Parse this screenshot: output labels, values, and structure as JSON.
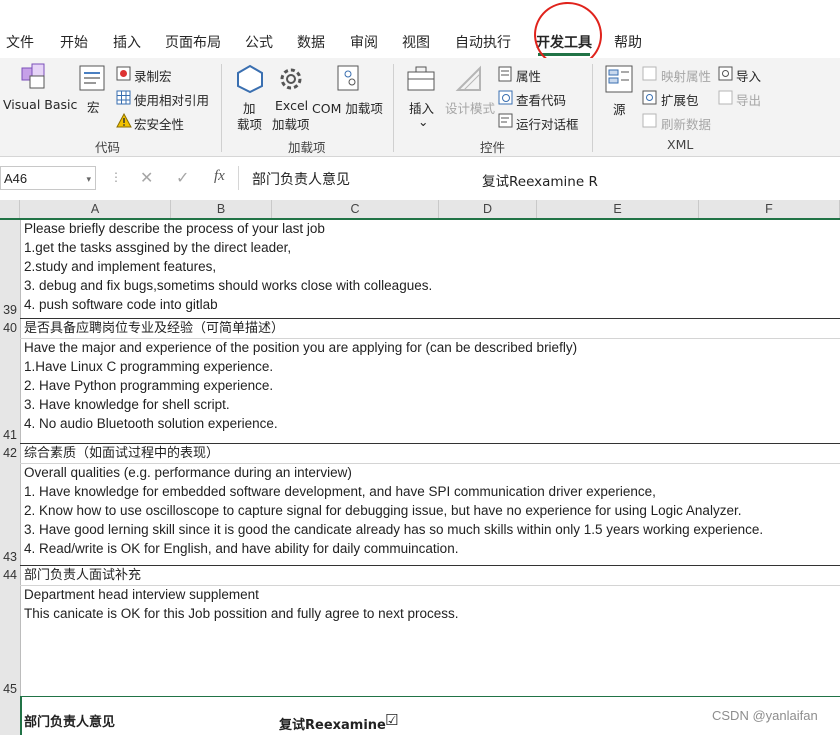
{
  "menu": {
    "tabs": [
      "文件",
      "开始",
      "插入",
      "页面布局",
      "公式",
      "数据",
      "审阅",
      "视图",
      "自动执行",
      "开发工具",
      "帮助"
    ],
    "active": "开发工具"
  },
  "ribbon": {
    "code": {
      "label": "代码",
      "visual_basic": "Visual Basic",
      "macro": "宏",
      "record_macro": "录制宏",
      "relative_ref": "使用相对引用",
      "macro_security": "宏安全性"
    },
    "addins": {
      "label": "加载项",
      "addin_line1": "加",
      "addin_line2": "载项",
      "excel_line1": "Excel",
      "excel_line2": "加载项",
      "com": "COM 加载项"
    },
    "controls": {
      "label": "控件",
      "insert": "插入",
      "design_mode": "设计模式",
      "properties": "属性",
      "view_code": "查看代码",
      "run_dialog": "运行对话框"
    },
    "xml": {
      "label": "XML",
      "source": "源",
      "map_properties": "映射属性",
      "expansion_packs": "扩展包",
      "refresh_data": "刷新数据",
      "import": "导入",
      "export": "导出"
    }
  },
  "formula_bar": {
    "name_box": "A46",
    "fx": "fx",
    "content": "部门负责人意见",
    "content_right": "复试Reexamine R"
  },
  "columns": [
    "A",
    "B",
    "C",
    "D",
    "E",
    "F"
  ],
  "rows": [
    {
      "number": "39",
      "lines": [
        "Please briefly describe the process of your last job",
        "1.get the tasks assgined by the direct leader,",
        "2.study and implement features,",
        "3. debug and fix bugs,sometims should works close with colleagues.",
        "4. push software code into gitlab"
      ]
    },
    {
      "number": "40",
      "lines": [
        "是否具备应聘岗位专业及经验（可简单描述）"
      ]
    },
    {
      "number": "41",
      "lines": [
        "Have the major and experience of the position you are applying for (can be described briefly)",
        "1.Have Linux C programming experience.",
        "2. Have Python programming experience.",
        "3. Have knowledge for shell script.",
        "4. No audio Bluetooth solution experience."
      ]
    },
    {
      "number": "42",
      "lines": [
        "综合素质（如面试过程中的表现）"
      ]
    },
    {
      "number": "43",
      "lines": [
        "Overall qualities (e.g. performance during an interview)",
        "1. Have knowledge for embedded software development, and have SPI communication driver experience,",
        "2. Know how to use oscilloscope to capture signal for debugging issue, but have no experience for using Logic Analyzer.",
        "3. Have good lerning skill since it is good the candicate already has so much skills within only 1.5 years working experience.",
        "4. Read/write is OK for English, and have ability for daily commuincation."
      ]
    },
    {
      "number": "44",
      "lines": [
        "部门负责人面试补充"
      ]
    },
    {
      "number": "45",
      "lines": [
        "Department head interview supplement",
        "This canicate is OK for this Job possition and fully agree to next process."
      ]
    }
  ],
  "last_row": {
    "opinion": "部门负责人意见",
    "reexamine": "复试Reexamine",
    "checkbox": "☑"
  },
  "watermark": "CSDN @yanlaifan",
  "colors": {
    "accent": "#217346",
    "annotation": "#e0231c"
  }
}
